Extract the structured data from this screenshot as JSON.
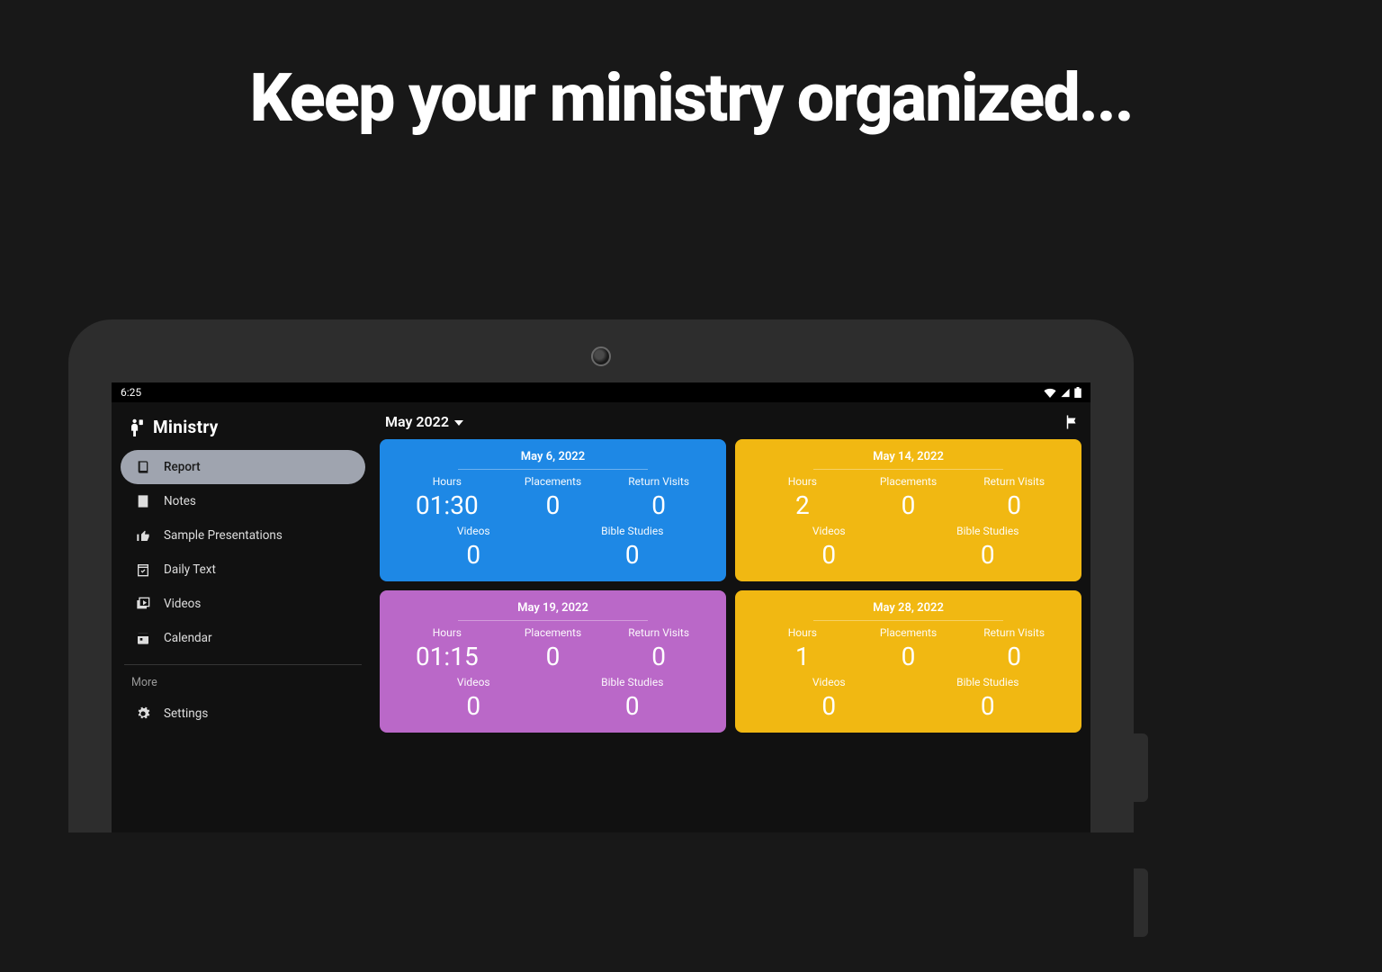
{
  "headline": "Keep your ministry organized...",
  "status": {
    "time": "6:25"
  },
  "brand": {
    "title": "Ministry"
  },
  "sidebar": {
    "items": [
      {
        "label": "Report"
      },
      {
        "label": "Notes"
      },
      {
        "label": "Sample Presentations"
      },
      {
        "label": "Daily Text"
      },
      {
        "label": "Videos"
      },
      {
        "label": "Calendar"
      }
    ],
    "more_label": "More",
    "settings_label": "Settings"
  },
  "topbar": {
    "month_label": "May 2022"
  },
  "metric_labels": {
    "hours": "Hours",
    "placements": "Placements",
    "return_visits": "Return Visits",
    "videos": "Videos",
    "bible_studies": "Bible Studies"
  },
  "cards": [
    {
      "date": "May 6, 2022",
      "hours": "01:30",
      "placements": "0",
      "return_visits": "0",
      "videos": "0",
      "bible_studies": "0",
      "color": "blue"
    },
    {
      "date": "May 14, 2022",
      "hours": "2",
      "placements": "0",
      "return_visits": "0",
      "videos": "0",
      "bible_studies": "0",
      "color": "yellow"
    },
    {
      "date": "May 19, 2022",
      "hours": "01:15",
      "placements": "0",
      "return_visits": "0",
      "videos": "0",
      "bible_studies": "0",
      "color": "purple"
    },
    {
      "date": "May 28, 2022",
      "hours": "1",
      "placements": "0",
      "return_visits": "0",
      "videos": "0",
      "bible_studies": "0",
      "color": "yellow"
    }
  ]
}
